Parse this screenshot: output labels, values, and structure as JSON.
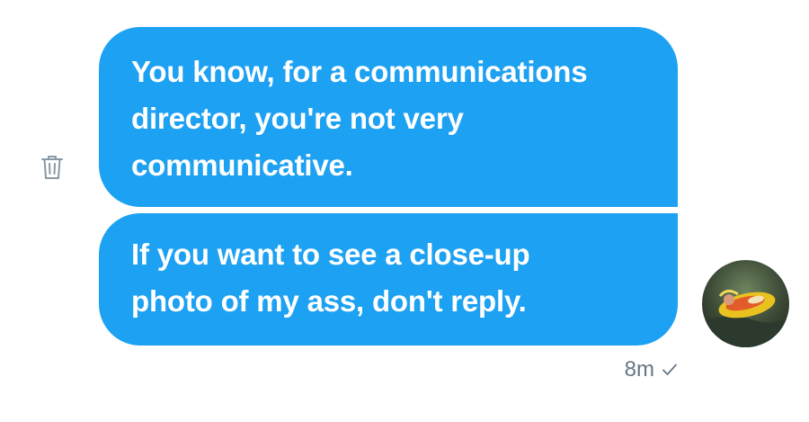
{
  "theme": {
    "bubble_color": "#1da1f2",
    "meta_color": "#657786",
    "icon_color": "#8899a6"
  },
  "conversation": {
    "messages": [
      {
        "text": "You know, for a communications\ndirector, you're not very\ncommunicative.",
        "sender": "self"
      },
      {
        "text": "If you want to see a close-up\nphoto of my ass, don't reply.",
        "sender": "self"
      }
    ],
    "delete_icon": "trash-icon",
    "status": {
      "time": "8m",
      "read_icon": "checkmark-icon"
    }
  }
}
